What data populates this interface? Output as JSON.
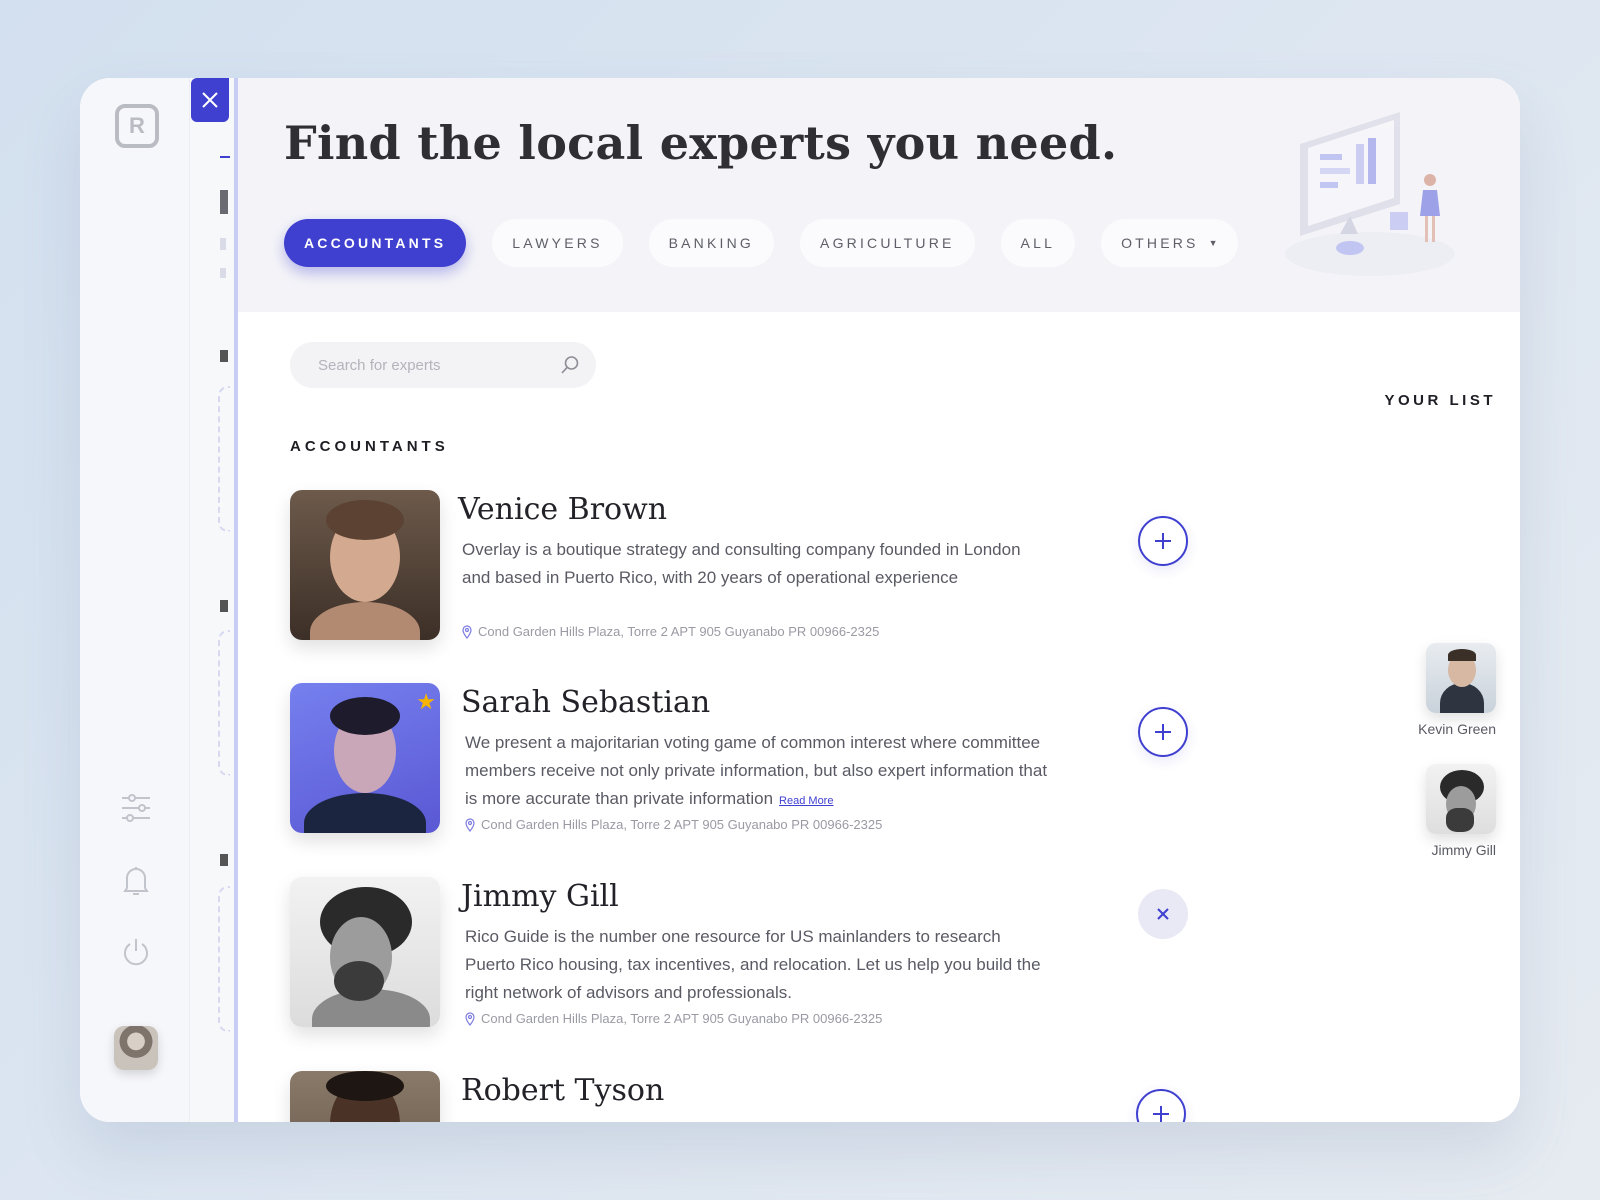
{
  "app": {
    "logo_letter": "R",
    "close_icon": "close-icon"
  },
  "header": {
    "title": "Find the local experts you need.",
    "tabs": [
      {
        "label": "ACCOUNTANTS",
        "active": true
      },
      {
        "label": "LAWYERS",
        "active": false
      },
      {
        "label": "BANKING",
        "active": false
      },
      {
        "label": "AGRICULTURE",
        "active": false
      },
      {
        "label": "ALL",
        "active": false
      },
      {
        "label": "OTHERS",
        "active": false
      }
    ]
  },
  "search": {
    "placeholder": "Search for experts",
    "value": ""
  },
  "section": {
    "title": "ACCOUNTANTS"
  },
  "experts": [
    {
      "name": "Venice Brown",
      "description": "Overlay is a boutique strategy and consulting company founded in London and based in Puerto Rico, with 20 years of operational experience",
      "address": "Cond Garden Hills Plaza, Torre 2 APT 905 Guyanabo PR 00966-2325",
      "action": "add",
      "featured": false
    },
    {
      "name": "Sarah Sebastian",
      "description": "We present a majoritarian voting game of common interest where committee members receive not only private information, but also expert information that is more accurate than private information",
      "read_more": "Read More",
      "address": "Cond Garden Hills Plaza, Torre 2 APT 905 Guyanabo PR 00966-2325",
      "action": "add",
      "featured": true
    },
    {
      "name": "Jimmy Gill",
      "description": "Rico Guide is the number one resource for US mainlanders to research Puerto Rico housing, tax incentives, and relocation. Let us help you build the right network of advisors and professionals.",
      "address": "Cond Garden Hills Plaza, Torre 2 APT 905 Guyanabo PR 00966-2325",
      "action": "remove",
      "featured": false
    },
    {
      "name": "Robert Tyson",
      "description": "",
      "address": "",
      "action": "add",
      "featured": false
    }
  ],
  "your_list": {
    "title": "YOUR LIST",
    "items": [
      {
        "name": "Kevin Green"
      },
      {
        "name": "Jimmy Gill"
      }
    ]
  },
  "colors": {
    "accent": "#3f3fd0",
    "star": "#f7b500",
    "header_bg": "#f4f4f8"
  }
}
